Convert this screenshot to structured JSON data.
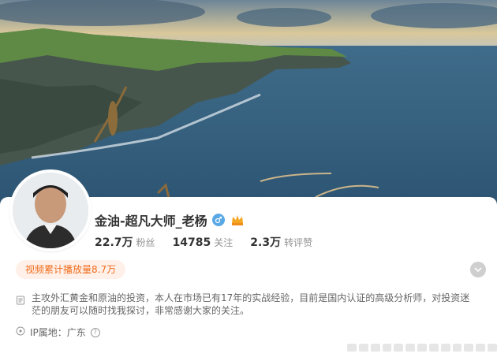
{
  "profile": {
    "name": "金油-超凡大师_老杨",
    "gender": "male",
    "stats": {
      "followers_value": "22.7万",
      "followers_label": "粉丝",
      "following_value": "14785",
      "following_label": "关注",
      "reposts_value": "2.3万",
      "reposts_label": "转评赞"
    },
    "video_badge": "视频累计播放量8.7万",
    "bio": "主攻外汇黄金和原油的投资，本人在市场已有17年的实战经验，目前是国内认证的高级分析师，对投资迷茫的朋友可以随时找我探讨，非常感谢大家的关注。",
    "ip_label": "IP属地：广东"
  },
  "icons": {
    "gender": "male-icon",
    "crown": "crown-badge-icon",
    "expand": "chevron-down-icon",
    "bio": "document-icon",
    "ip": "location-icon",
    "help": "question-icon"
  },
  "colors": {
    "accent": "#f06c1c",
    "badge_bg": "#fff1e9",
    "gender_blue": "#5aa9e6",
    "text_dark": "#333333",
    "text_gray": "#939393"
  }
}
